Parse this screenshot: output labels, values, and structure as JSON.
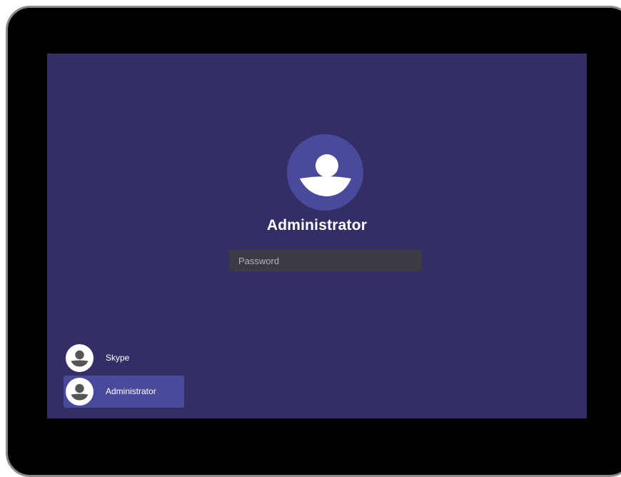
{
  "login": {
    "current_user": "Administrator",
    "password_placeholder": "Password",
    "password_value": ""
  },
  "user_list": [
    {
      "name": "Skype",
      "selected": false
    },
    {
      "name": "Administrator",
      "selected": true
    }
  ],
  "icons": {
    "large_avatar": "user-avatar-icon",
    "small_avatar": "user-avatar-icon"
  },
  "colors": {
    "screen_background": "#332f66",
    "accent": "#4a4a9a",
    "password_field": "#3c3b43"
  }
}
